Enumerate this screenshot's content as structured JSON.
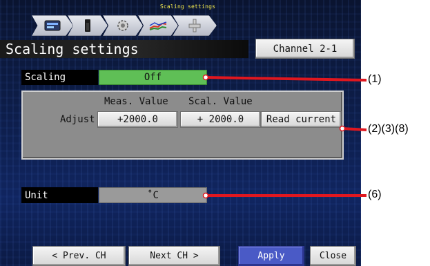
{
  "breadcrumb": {
    "caption": "Scaling settings",
    "icons": [
      "monitor-icon",
      "bar-meter-icon",
      "gear-icon",
      "signal-wave-icon",
      "channel-connector-icon"
    ]
  },
  "title": {
    "text": "Scaling settings"
  },
  "channel_button": {
    "label": "Channel 2-1"
  },
  "scaling": {
    "label": "Scaling",
    "value": "Off",
    "value_color": "#5fbf56"
  },
  "adjust": {
    "label": "Adjust",
    "meas_header": "Meas. Value",
    "scal_header": "Scal. Value",
    "meas_value": "+2000.0",
    "scal_value": "+ 2000.0",
    "read_button": "Read current"
  },
  "unit": {
    "label": "Unit",
    "value": "˚C"
  },
  "footer": {
    "prev_label": "< Prev. CH",
    "next_label": "Next CH >",
    "apply_label": "Apply",
    "close_label": "Close",
    "apply_color": "#4a5ac6"
  },
  "callouts": {
    "c1": "(1)",
    "c2": "(2)(3)(8)",
    "c6": "(6)",
    "line_color": "#e0171f"
  }
}
